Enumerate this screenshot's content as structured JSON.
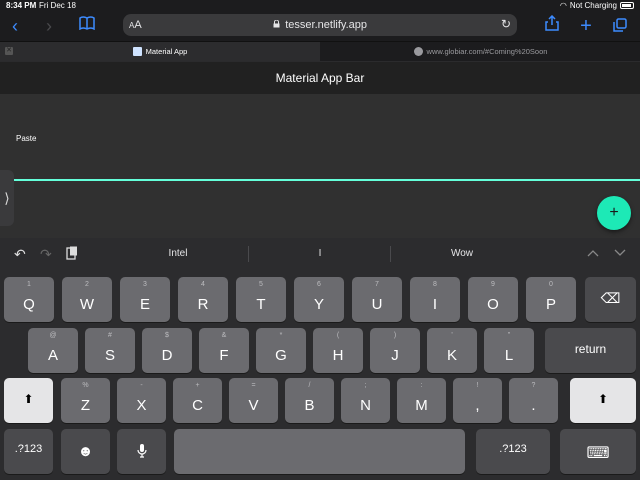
{
  "status": {
    "time": "8:34 PM",
    "date": "Fri Dec 18",
    "charge": "Not Charging"
  },
  "toolbar": {
    "back_icon": "‹",
    "forward_icon": "›",
    "bookmarks_icon": "📖",
    "aa_small": "A",
    "aa_large": "A",
    "url": "tesser.netlify.app",
    "lock_icon": "🔒",
    "reload_icon": "↻",
    "share_icon": "⇪",
    "new_tab_icon": "+",
    "tabs_icon": "⧉"
  },
  "tabs": [
    {
      "title": "Material App"
    },
    {
      "title": "www.globiar.com/#Coming%20Soon"
    }
  ],
  "page": {
    "appbar_title": "Material App Bar",
    "paste_label": "Paste",
    "fab_icon": "+",
    "side_handle_icon": "⟩"
  },
  "keyboard": {
    "undo_icon": "↶",
    "redo_icon": "↷",
    "clipboard_icon": "📋",
    "suggestions": [
      "Intel",
      "I",
      "Wow"
    ],
    "chevron_up": "^",
    "chevron_down": "v",
    "row1": [
      {
        "sub": "1",
        "main": "Q"
      },
      {
        "sub": "2",
        "main": "W"
      },
      {
        "sub": "3",
        "main": "E"
      },
      {
        "sub": "4",
        "main": "R"
      },
      {
        "sub": "5",
        "main": "T"
      },
      {
        "sub": "6",
        "main": "Y"
      },
      {
        "sub": "7",
        "main": "U"
      },
      {
        "sub": "8",
        "main": "I"
      },
      {
        "sub": "9",
        "main": "O"
      },
      {
        "sub": "0",
        "main": "P"
      }
    ],
    "backspace_icon": "⌫",
    "row2": [
      {
        "sub": "@",
        "main": "A"
      },
      {
        "sub": "#",
        "main": "S"
      },
      {
        "sub": "$",
        "main": "D"
      },
      {
        "sub": "&",
        "main": "F"
      },
      {
        "sub": "*",
        "main": "G"
      },
      {
        "sub": "(",
        "main": "H"
      },
      {
        "sub": ")",
        "main": "J"
      },
      {
        "sub": "'",
        "main": "K"
      },
      {
        "sub": "\"",
        "main": "L"
      }
    ],
    "return_label": "return",
    "shift_icon": "⬆",
    "row3": [
      {
        "sub": "%",
        "main": "Z"
      },
      {
        "sub": "-",
        "main": "X"
      },
      {
        "sub": "+",
        "main": "C"
      },
      {
        "sub": "=",
        "main": "V"
      },
      {
        "sub": "/",
        "main": "B"
      },
      {
        "sub": ";",
        "main": "N"
      },
      {
        "sub": ":",
        "main": "M"
      },
      {
        "sub": "!",
        "main": ","
      },
      {
        "sub": "?",
        "main": "."
      }
    ],
    "numbers_label": ".?123",
    "emoji_icon": "☻",
    "mic_icon": "🎤",
    "space_label": "",
    "hide_keyboard_icon": "⌨"
  },
  "colors": {
    "accent": "#1de9b6",
    "link": "#3d8bff",
    "underline": "#64ffda"
  }
}
